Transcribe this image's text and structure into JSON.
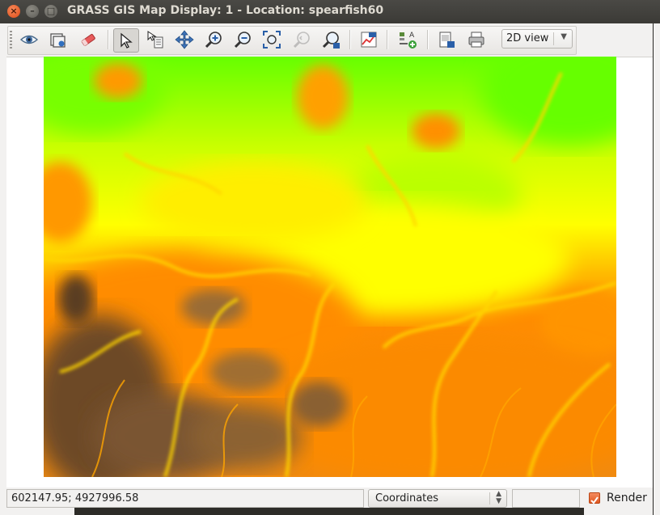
{
  "window": {
    "title": "GRASS GIS Map Display: 1  - Location: spearfish60",
    "controls": {
      "close": "×",
      "minimize": "–",
      "maximize": "□"
    }
  },
  "toolbar": {
    "buttons": [
      {
        "name": "display-map-icon",
        "tooltip": ""
      },
      {
        "name": "render-map-icon",
        "tooltip": ""
      },
      {
        "name": "erase-icon",
        "tooltip": ""
      },
      {
        "name": "pointer-icon",
        "tooltip": ""
      },
      {
        "name": "query-icon",
        "tooltip": ""
      },
      {
        "name": "pan-icon",
        "tooltip": ""
      },
      {
        "name": "zoom-in-icon",
        "tooltip": ""
      },
      {
        "name": "zoom-out-icon",
        "tooltip": ""
      },
      {
        "name": "zoom-extent-icon",
        "tooltip": ""
      },
      {
        "name": "zoom-back-icon",
        "tooltip": ""
      },
      {
        "name": "zoom-menu-icon",
        "tooltip": ""
      },
      {
        "name": "analyze-icon",
        "tooltip": ""
      },
      {
        "name": "overlay-icon",
        "tooltip": ""
      },
      {
        "name": "save-image-icon",
        "tooltip": ""
      },
      {
        "name": "print-icon",
        "tooltip": ""
      }
    ],
    "view_mode": "2D view"
  },
  "colors": {
    "map_low": "#5a3e22",
    "map_mid": "#ff8c00",
    "map_high": "#ffff00",
    "map_top": "#66ff00",
    "render_checkbox": "#e9622a"
  },
  "statusbar": {
    "coordinates": "602147.95; 4927996.58",
    "mode": "Coordinates",
    "render_label": "Render",
    "render_checked": true
  }
}
